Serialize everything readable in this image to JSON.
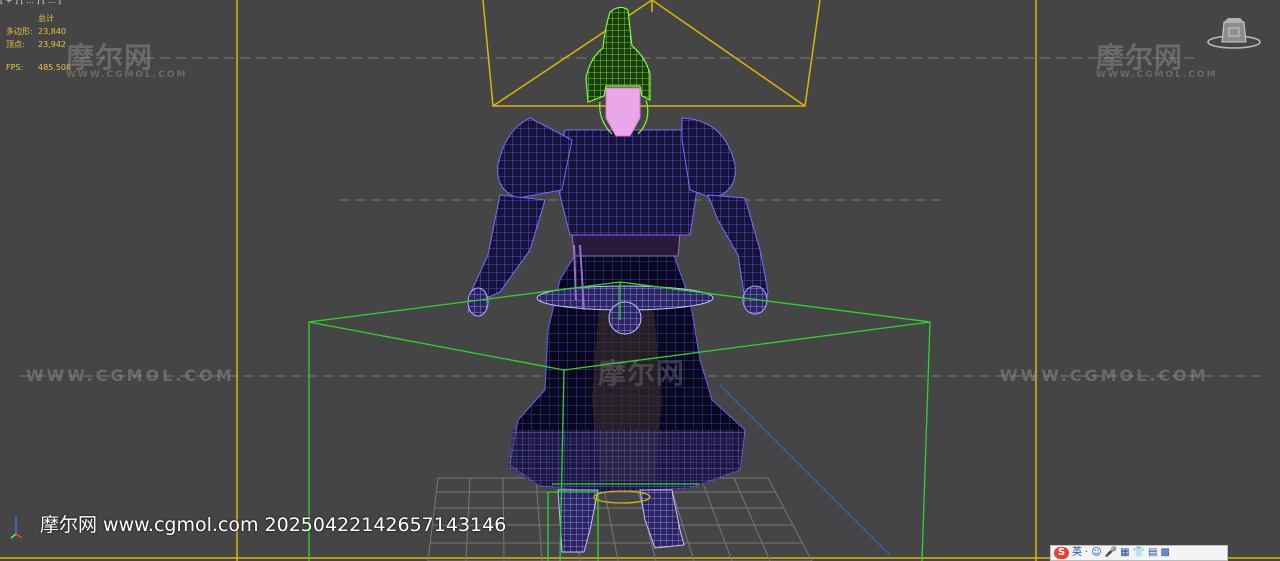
{
  "viewport": {
    "label": "[ + ] [ ... ] [ ... ]"
  },
  "stats": {
    "header": "总计",
    "polys_label": "多边形:",
    "polys_value": "23,840",
    "verts_label": "顶点:",
    "verts_value": "23,942",
    "fps_label": "FPS:",
    "fps_value": "485.508"
  },
  "watermarks": {
    "logo_cn": "摩尔网",
    "logo_url": "WWW.CGMOL.COM",
    "url": "WWW.CGMOL.COM",
    "footer": "摩尔网 www.cgmol.com 20250422142657143146"
  },
  "ime_toolbar": {
    "items": [
      "S",
      "英",
      "·",
      "☺",
      "🎤",
      "▦",
      "👕",
      "▤",
      "▩"
    ]
  },
  "colors": {
    "viewport_bg": "#454545",
    "frustum": "#d6b800",
    "selection_box": "#2bd62b",
    "body_wire": "#6655ee",
    "head_wire": "#66ff33",
    "grid": "#7a7a7a",
    "face": "#e9a6e8"
  }
}
